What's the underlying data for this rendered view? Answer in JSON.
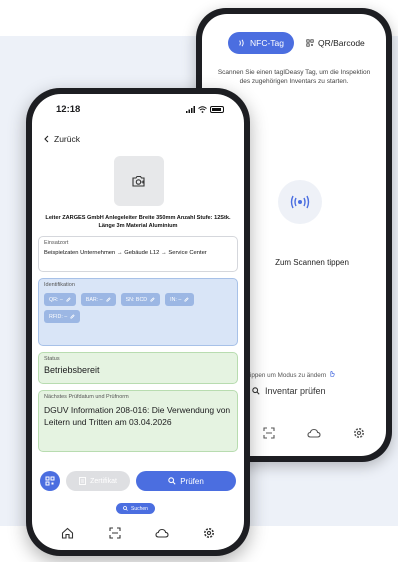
{
  "back_screen": {
    "tabs": [
      {
        "label": "NFC-Tag",
        "icon": "nfc-icon",
        "active": true
      },
      {
        "label": "QR/Barcode",
        "icon": "qr-code-icon",
        "active": false
      }
    ],
    "description": "Scannen Sie einen tagIDeasy Tag, um die Inspektion des zugehörigen Inventars zu starten.",
    "scan_label": "Zum Scannen tippen",
    "mode_hint": "hier tippen um Modus zu ändern",
    "inventory_check": "Inventar prüfen",
    "nav": [
      "scan-icon",
      "cloud-icon",
      "gear-icon"
    ]
  },
  "front_screen": {
    "time": "12:18",
    "back_label": "Zurück",
    "item_title": "Leiter ZARGES GmbH Anlegeleiter Breite 350mm Anzahl Stufe: 12Stk. Länge 3m Material Aluminium",
    "einsatzort": {
      "label": "Einsatzort",
      "value": "Beispielzaten Unternehmen → Gebäude L12 → Service Center"
    },
    "identifikation": {
      "label": "Identifikation",
      "chips": [
        "QR: –",
        "BAR: –",
        "SN: BCD",
        "IN: –",
        "RFID: –"
      ]
    },
    "status": {
      "label": "Status",
      "value": "Betriebsbereit"
    },
    "pruefung": {
      "label": "Nächstes Prüfdatum und Prüfnorm",
      "value": "DGUV Information 208-016: Die Verwendung von Leitern und Tritten am 03.04.2026"
    },
    "buttons": {
      "zertifikat": "Zertifikat",
      "pruefen": "Prüfen",
      "search": "Suchen"
    },
    "nav": [
      "home-icon",
      "scan-icon",
      "cloud-icon",
      "gear-icon"
    ]
  },
  "colors": {
    "accent": "#4b6ee0",
    "ident_bg": "#d9e5f7",
    "status_bg": "#e5f3e1",
    "panel_bg": "#edf1f8"
  }
}
